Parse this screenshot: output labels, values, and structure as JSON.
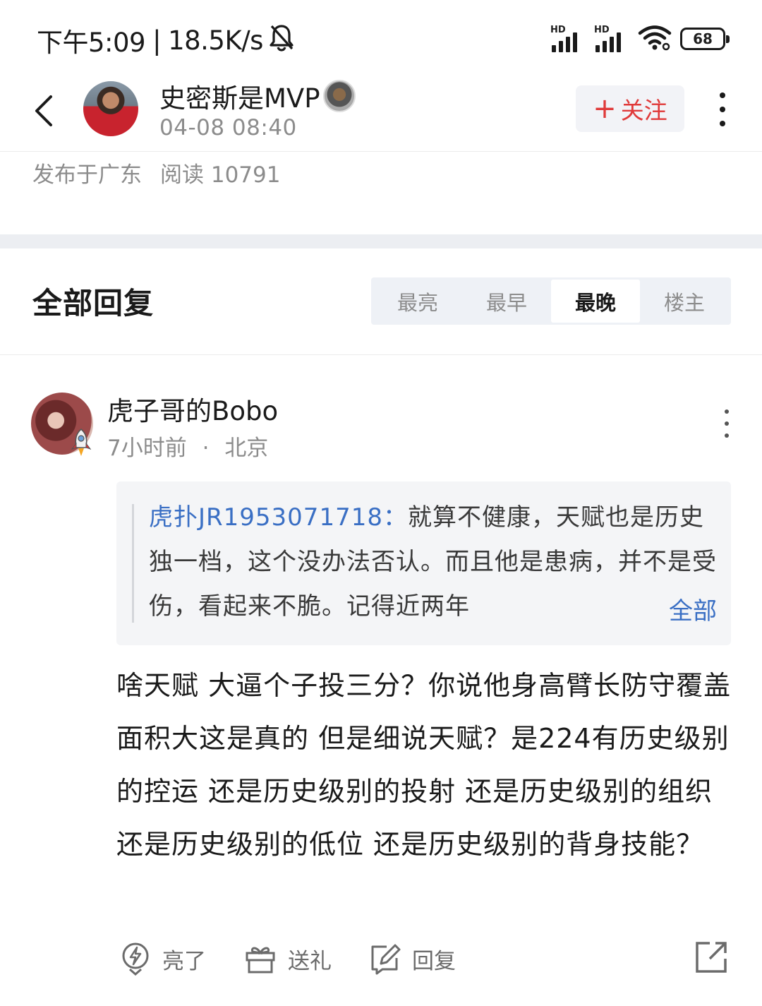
{
  "status_bar": {
    "time": "下午5:09",
    "separator": "|",
    "speed": "18.5K/s",
    "signal1_label": "HD",
    "signal2_label": "HD",
    "battery": "68",
    "icons": [
      "bell-muted-icon",
      "signal-icon",
      "signal-icon",
      "wifi-icon",
      "battery-icon"
    ]
  },
  "header": {
    "author": "史密斯是MVP",
    "post_time": "04-08 08:40",
    "follow_plus": "+",
    "follow_label": "关注",
    "icons": [
      "back-icon",
      "more-vertical-icon"
    ]
  },
  "post_meta": {
    "location": "发布于广东",
    "reads": "阅读 10791"
  },
  "replies": {
    "title": "全部回复",
    "sort_tabs": [
      {
        "label": "最亮",
        "active": false
      },
      {
        "label": "最早",
        "active": false
      },
      {
        "label": "最晚",
        "active": true
      },
      {
        "label": "楼主",
        "active": false
      }
    ]
  },
  "reply": {
    "user": "虎子哥的Bobo",
    "time": "7小时前",
    "dot": "·",
    "location": "北京",
    "quote": {
      "name": "虎扑JR1953071718：",
      "text": "就算不健康，天赋也是历史独一档，这个没办法否认。而且他是患病，并不是受伤，看起来不脆。记得近两年",
      "expand": "全部"
    },
    "content": "啥天赋 大逼个子投三分？你说他身高臂长防守覆盖面积大这是真的 但是细说天赋？是224有历史级别的控运 还是历史级别的投射 还是历史级别的组织 还是历史级别的低位 还是历史级别的背身技能？",
    "actions": {
      "light": "亮了",
      "gift": "送礼",
      "reply": "回复"
    }
  },
  "colors": {
    "accent_red": "#e03a3a",
    "link_blue": "#3a6fc4",
    "muted": "#8c8c8c"
  }
}
